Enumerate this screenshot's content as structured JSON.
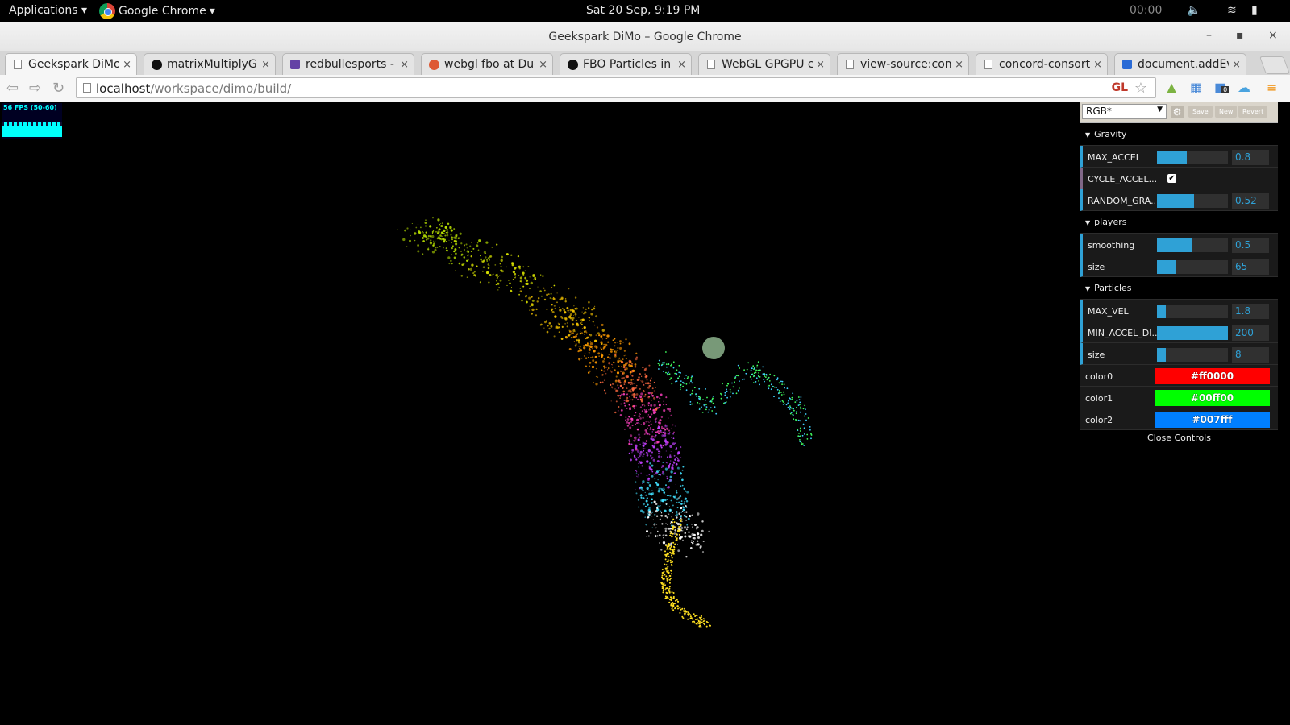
{
  "topbar": {
    "applications_label": "Applications",
    "chrome_label": "Google Chrome",
    "clock": "Sat 20 Sep,  9:19 PM",
    "timer": "00:00"
  },
  "window": {
    "title": "Geekspark DiMo – Google Chrome",
    "minimize": "–",
    "maximize": "▪",
    "close": "×"
  },
  "tabs": [
    {
      "label": "Geekspark DiMo",
      "icon": "page-icon"
    },
    {
      "label": "matrixMultiplyGpu",
      "icon": "github-icon"
    },
    {
      "label": "redbullesports - Tw",
      "icon": "twitch-icon"
    },
    {
      "label": "webgl fbo at Duck",
      "icon": "duckduckgo-icon"
    },
    {
      "label": "FBO Particles in Th",
      "icon": "github-icon"
    },
    {
      "label": "WebGL GPGPU exp",
      "icon": "page-icon"
    },
    {
      "label": "view-source:conco",
      "icon": "page-icon"
    },
    {
      "label": "concord-consortiun",
      "icon": "page-icon"
    },
    {
      "label": "document.addEven",
      "icon": "blue-page-icon"
    }
  ],
  "tab_close": "×",
  "omnibox": {
    "host": "localhost",
    "path": "/workspace/dimo/build/",
    "gl_badge": "GL",
    "badge_count": "0"
  },
  "stats": {
    "fps_text": "56 FPS (50-60)"
  },
  "gui": {
    "preset": "RGB*",
    "save": "Save",
    "new": "New",
    "revert": "Revert",
    "folders": [
      {
        "name": "Gravity",
        "controllers": [
          {
            "label": "MAX_ACCEL",
            "type": "number",
            "value": "0.8",
            "fill": 0.42
          },
          {
            "label": "CYCLE_ACCEL...",
            "type": "boolean",
            "checked": true
          },
          {
            "label": "RANDOM_GRA...",
            "type": "number",
            "value": "0.52",
            "fill": 0.52
          }
        ]
      },
      {
        "name": "players",
        "controllers": [
          {
            "label": "smoothing",
            "type": "number",
            "value": "0.5",
            "fill": 0.5
          },
          {
            "label": "size",
            "type": "number",
            "value": "65",
            "fill": 0.26
          }
        ]
      },
      {
        "name": "Particles",
        "controllers": [
          {
            "label": "MAX_VEL",
            "type": "number",
            "value": "1.8",
            "fill": 0.12
          },
          {
            "label": "MIN_ACCEL_DI...",
            "type": "number",
            "value": "200",
            "fill": 1.0
          },
          {
            "label": "size",
            "type": "number",
            "value": "8",
            "fill": 0.12
          },
          {
            "label": "color0",
            "type": "color",
            "value": "#ff0000"
          },
          {
            "label": "color1",
            "type": "color",
            "value": "#00ff00"
          },
          {
            "label": "color2",
            "type": "color",
            "value": "#007fff"
          }
        ]
      }
    ],
    "close_label": "Close Controls"
  },
  "colors": {
    "gui_accent": "#2fa1d6",
    "fps_cyan": "#00ffff"
  }
}
